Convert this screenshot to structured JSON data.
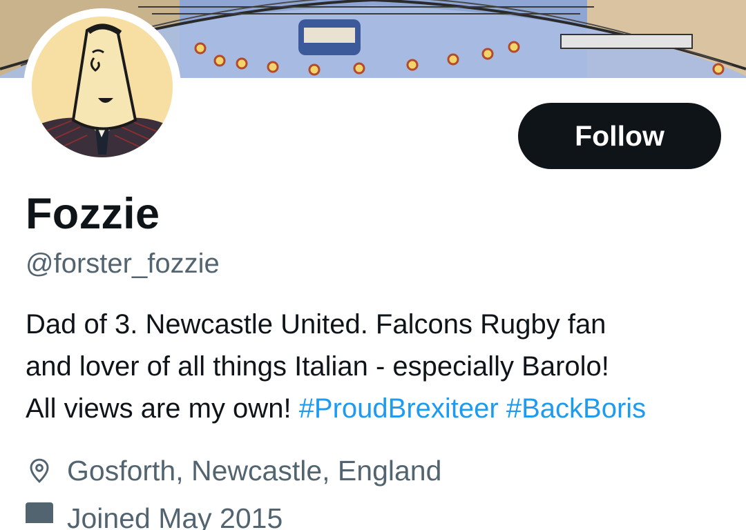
{
  "profile": {
    "name": "Fozzie",
    "handle": "@forster_fozzie",
    "follow_label": "Follow",
    "bio": {
      "line1": "Dad of 3. Newcastle United. Falcons Rugby fan",
      "line2": "and lover of all things Italian - especially Barolo!",
      "line3_text": "All views are my own!",
      "hashtags": [
        "#ProudBrexiteer",
        "#BackBoris"
      ]
    },
    "location": "Gosforth, Newcastle, England",
    "joined_partial": "Joined May 2015"
  },
  "colors": {
    "link": "#1d9bf0",
    "secondary_text": "#536471",
    "primary_text": "#0f1419",
    "button_bg": "#0f1419"
  },
  "icons": {
    "location": "map-pin-icon",
    "calendar": "calendar-icon"
  }
}
